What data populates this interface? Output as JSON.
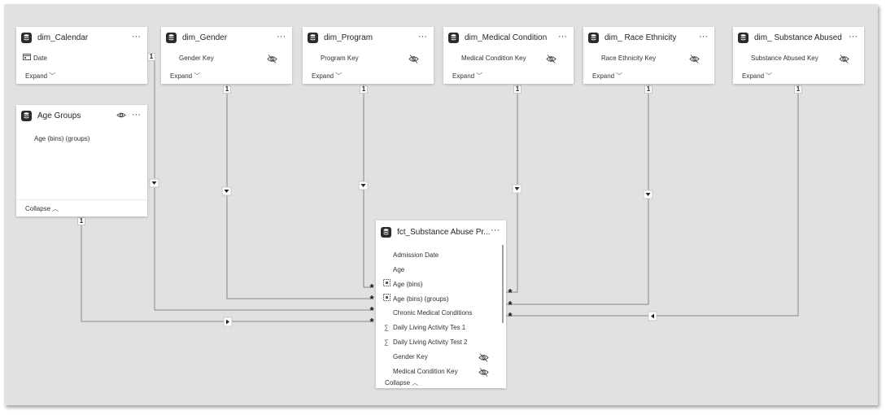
{
  "tables": {
    "calendar": {
      "title": "dim_Calendar",
      "field": "Date",
      "footer": "Expand"
    },
    "gender": {
      "title": "dim_Gender",
      "field": "Gender Key",
      "footer": "Expand"
    },
    "program": {
      "title": "dim_Program",
      "field": "Program Key",
      "footer": "Expand"
    },
    "medical": {
      "title": "dim_Medical Condition",
      "field": "Medical Condition Key",
      "footer": "Expand"
    },
    "race": {
      "title": "dim_ Race Ethnicity",
      "field": "Race Ethnicity Key",
      "footer": "Expand"
    },
    "substance": {
      "title": "dim_ Substance Abused",
      "field": "Substance Abused Key",
      "footer": "Expand"
    },
    "age_groups": {
      "title": "Age Groups",
      "field": "Age (bins) (groups)",
      "footer": "Collapse"
    },
    "fact": {
      "title": "fct_Substance Abuse Pr...",
      "footer": "Collapse",
      "fields": [
        "Admission Date",
        "Age",
        "Age (bins)",
        "Age (bins) (groups)",
        "Chronic Medical Conditions",
        "Daily Living Activity Tes 1",
        "Daily Living Activity Test 2",
        "Gender Key",
        "Medical Condition Key"
      ]
    }
  },
  "markers": {
    "one": "1",
    "many": "*"
  },
  "menu_glyph": "···",
  "icons": {
    "table": "table-icon",
    "hidden": "eye-slash-icon",
    "visible": "eye-icon",
    "calendar": "calendar-icon",
    "sum": "sigma-icon",
    "bins": "bins-icon"
  },
  "colors": {
    "canvas": "#e2e1df",
    "line": "#8a8886",
    "card": "#ffffff"
  }
}
